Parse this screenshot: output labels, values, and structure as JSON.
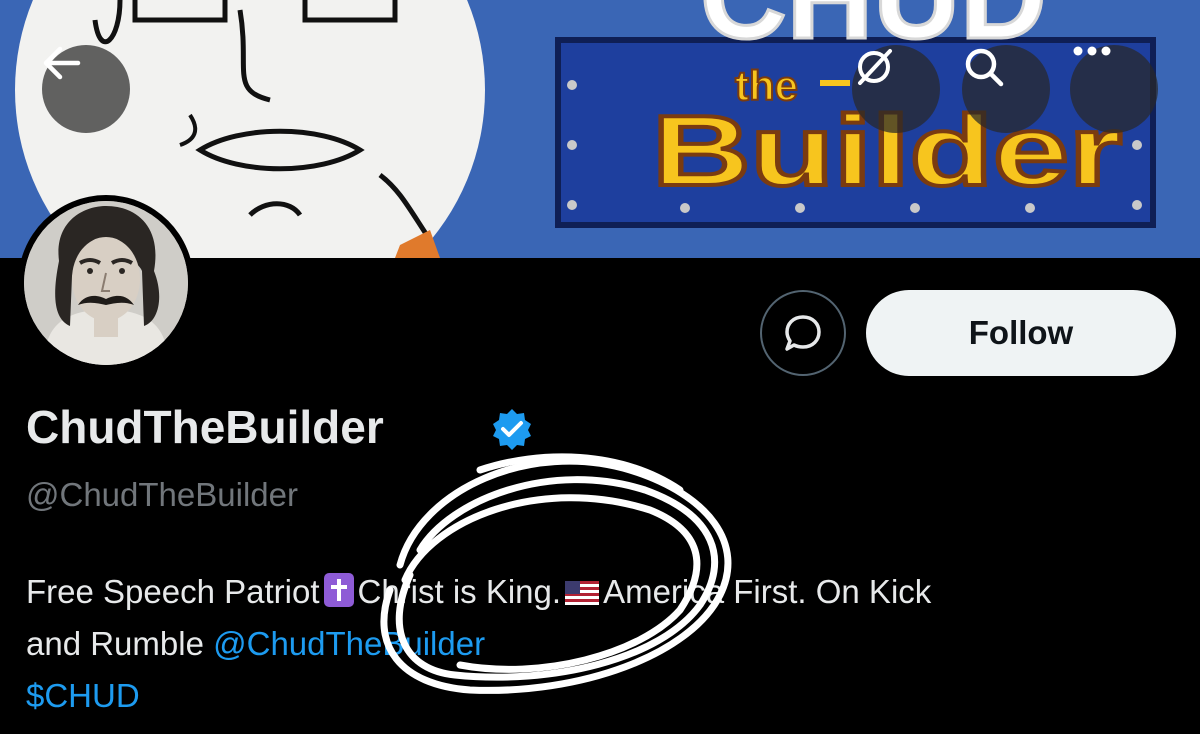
{
  "banner": {
    "title_top": "CHUD",
    "title_mid": "the",
    "title_bottom": "Builder"
  },
  "header": {
    "back_icon": "arrow-left-icon",
    "grok_icon": "grok-icon",
    "search_icon": "search-icon",
    "more_icon": "more-icon"
  },
  "profile": {
    "display_name": "ChudTheBuilder",
    "handle": "@ChudTheBuilder",
    "verified": true,
    "follow_label": "Follow",
    "message_icon": "message-icon",
    "bio": {
      "line1_a": "Free Speech Patriot",
      "line1_b": "Christ is King.",
      "line1_c": "America First. On Kick",
      "line2_a": "and Rumble ",
      "line2_link": "@ChudTheBuilder",
      "line3_link": "$CHUD"
    }
  },
  "colors": {
    "background": "#000000",
    "banner_blue": "#3a66b5",
    "link": "#1d9bf0",
    "verified": "#1d9bf0",
    "muted": "#71767b"
  }
}
